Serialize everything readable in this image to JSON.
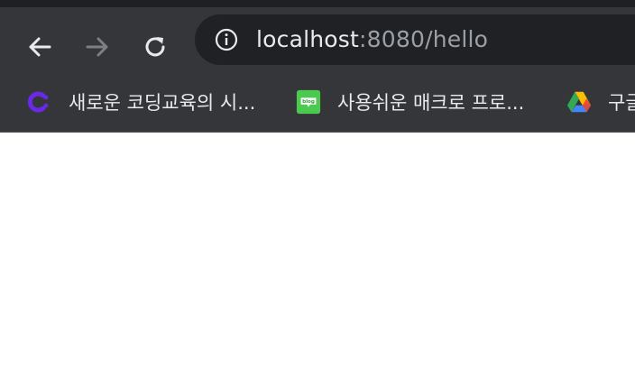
{
  "window": {
    "top_strip_color": "#1f2023"
  },
  "toolbar": {
    "back_icon": "arrow-left-icon",
    "forward_icon": "arrow-right-icon",
    "reload_icon": "reload-icon",
    "info_icon": "info-icon",
    "url_host": "localhost",
    "url_rest": ":8080/hello"
  },
  "bookmarks": {
    "items": [
      {
        "label": "새로운 코딩교육의 시...",
        "icon": "codeit-logo-icon"
      },
      {
        "label": "사용쉬운 매크로 프로...",
        "icon": "blog-icon",
        "icon_text": "blog"
      },
      {
        "label": "구글",
        "icon": "google-drive-icon"
      }
    ]
  },
  "colors": {
    "toolbar_bg": "#35363a",
    "omnibox_bg": "#202124",
    "url_host": "#e8eaed",
    "url_rest": "#9aa0a6",
    "page_bg": "#ffffff"
  }
}
